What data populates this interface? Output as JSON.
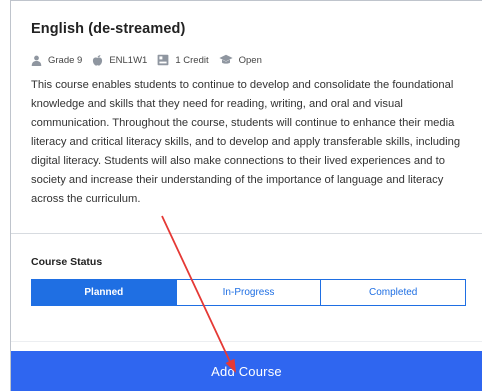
{
  "course": {
    "title": "English (de-streamed)",
    "meta": {
      "grade": "Grade 9",
      "code": "ENL1W1",
      "credit": "1 Credit",
      "availability": "Open"
    },
    "description": "This course enables students to continue to develop and consolidate the foundational knowledge and skills that they need for reading, writing, and oral and visual communication. Throughout the course, students will continue to enhance their media literacy and critical literacy skills, and to develop and apply transferable skills, including digital literacy. Students will also make connections to their lived experiences and to society and increase their understanding of the importance of language and literacy across the curriculum."
  },
  "status": {
    "label": "Course Status",
    "options": [
      "Planned",
      "In-Progress",
      "Completed"
    ],
    "selected": "Planned"
  },
  "actions": {
    "add_course": "Add Course"
  },
  "colors": {
    "primary": "#1f6fe3",
    "add_button": "#2f66f0",
    "annotation_arrow": "#e53935",
    "icon_gray": "#8f96a0"
  },
  "icons": {
    "grade": "person-icon",
    "code": "apple-icon",
    "credit": "book-icon",
    "availability": "graduation-cap-icon"
  }
}
